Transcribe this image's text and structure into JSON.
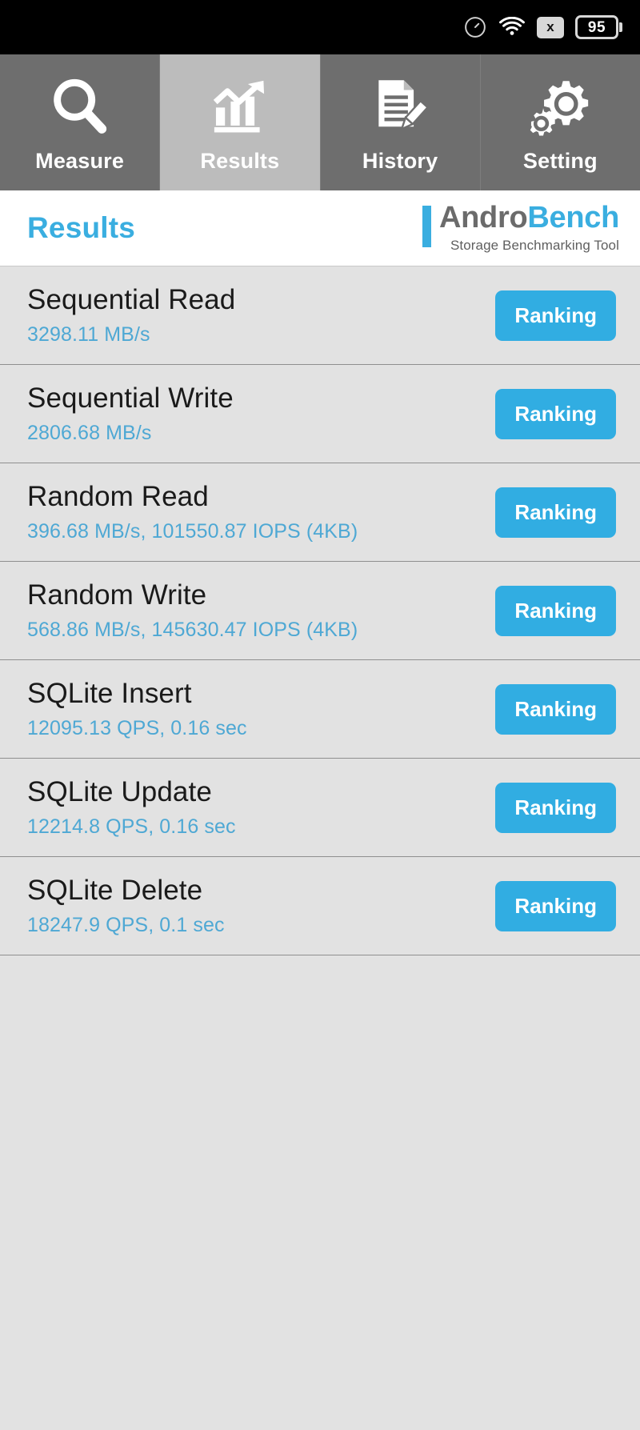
{
  "statusbar": {
    "icons": [
      "speedometer-icon",
      "wifi-icon",
      "no-sim-icon"
    ],
    "no_sim_label": "x",
    "battery_level": "95"
  },
  "tabs": [
    {
      "label": "Measure",
      "icon": "magnifier-icon",
      "active": false
    },
    {
      "label": "Results",
      "icon": "chart-growth-icon",
      "active": true
    },
    {
      "label": "History",
      "icon": "document-pencil-icon",
      "active": false
    },
    {
      "label": "Setting",
      "icon": "gears-icon",
      "active": false
    }
  ],
  "header": {
    "title": "Results",
    "brand_first": "Andro",
    "brand_second": "Bench",
    "brand_subtitle": "Storage Benchmarking Tool"
  },
  "results": [
    {
      "title": "Sequential Read",
      "value": "3298.11 MB/s",
      "button": "Ranking"
    },
    {
      "title": "Sequential Write",
      "value": "2806.68 MB/s",
      "button": "Ranking"
    },
    {
      "title": "Random Read",
      "value": "396.68 MB/s, 101550.87 IOPS (4KB)",
      "button": "Ranking"
    },
    {
      "title": "Random Write",
      "value": "568.86 MB/s, 145630.47 IOPS (4KB)",
      "button": "Ranking"
    },
    {
      "title": "SQLite Insert",
      "value": "12095.13 QPS, 0.16 sec",
      "button": "Ranking"
    },
    {
      "title": "SQLite Update",
      "value": "12214.8 QPS, 0.16 sec",
      "button": "Ranking"
    },
    {
      "title": "SQLite Delete",
      "value": "18247.9 QPS, 0.1 sec",
      "button": "Ranking"
    }
  ],
  "colors": {
    "accent": "#31ade2",
    "value_text": "#4ea8d4",
    "tab_inactive": "#6e6e6e",
    "tab_active": "#bcbcbc",
    "list_bg": "#e2e2e2"
  }
}
